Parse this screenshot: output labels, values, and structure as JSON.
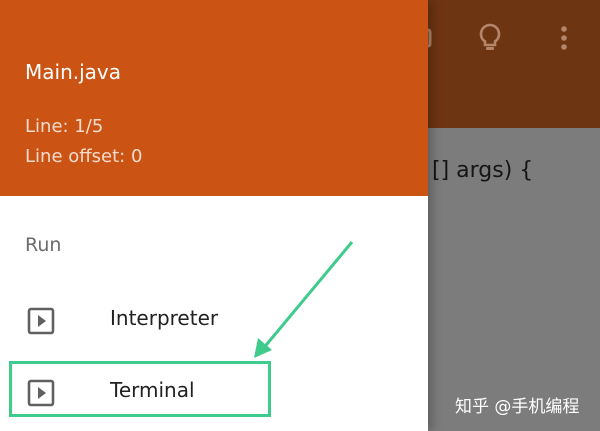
{
  "drawer": {
    "file_name": "Main.java",
    "line": "Line: 1/5",
    "line_offset": "Line offset: 0",
    "section_run": "Run",
    "items": [
      {
        "label": "Interpreter",
        "icon": "play-box-icon"
      },
      {
        "label": "Terminal",
        "icon": "play-box-icon"
      }
    ]
  },
  "background": {
    "code_snippet": "[] args) {",
    "toolbar_icons": [
      "tab-icon",
      "lightbulb-icon",
      "more-vertical-icon"
    ]
  },
  "watermark": "知乎 @手机编程",
  "colors": {
    "header": "#cb5415",
    "highlight": "#3ecb8c",
    "toolbar_dim": "#6e3512"
  }
}
